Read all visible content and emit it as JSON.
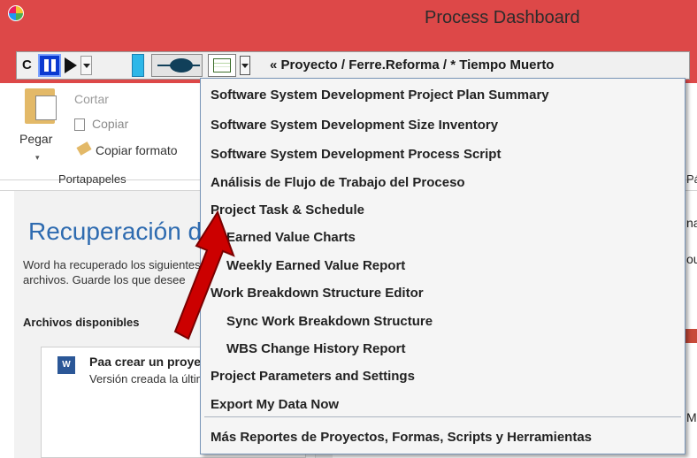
{
  "process_dashboard": {
    "title": "Process Dashboard",
    "toolbar": {
      "c_label": "C",
      "path": "« Proyecto / Ferre.Reforma / * Tiempo Muerto"
    }
  },
  "word": {
    "ribbon": {
      "cortar": "Cortar",
      "copiar": "Copiar",
      "pegar": "Pegar",
      "copiar_formato": "Copiar formato",
      "portapapeles": "Portapapeles",
      "pa_right": "Pá"
    },
    "recovery": {
      "title": "Recuperación de documentos",
      "text1": "Word ha recuperado los siguientes",
      "text2": "archivos. Guarde los que desee",
      "files_heading": "Archivos disponibles",
      "file_name": "Paa crear un proyecto.docx",
      "file_sub": "Versión creada la última vez",
      "word_icon": "W"
    },
    "right_fragments": {
      "t1": "na",
      "t2": "ou",
      "t3": "M"
    }
  },
  "menu": {
    "items": [
      {
        "label": "Software System Development Project Plan Summary"
      },
      {
        "label": "Software System Development Size Inventory"
      },
      {
        "label": "Software System Development Process Script"
      },
      {
        "label": "Análisis de Flujo de Trabajo del Proceso"
      },
      {
        "label": "Project Task & Schedule"
      },
      {
        "label": "Earned Value Charts"
      },
      {
        "label": "Weekly Earned Value Report"
      },
      {
        "label": "Work Breakdown Structure Editor"
      },
      {
        "label": "Sync Work Breakdown Structure"
      },
      {
        "label": "WBS Change History Report"
      },
      {
        "label": "Project Parameters and Settings"
      },
      {
        "label": "Export My Data Now"
      },
      {
        "label": "Más Reportes de Proyectos, Formas, Scripts y Herramientas"
      }
    ]
  },
  "colors": {
    "titlebar": "#dd4848",
    "arrow": "#cc0000",
    "recovery_title": "#2e6bb0"
  }
}
